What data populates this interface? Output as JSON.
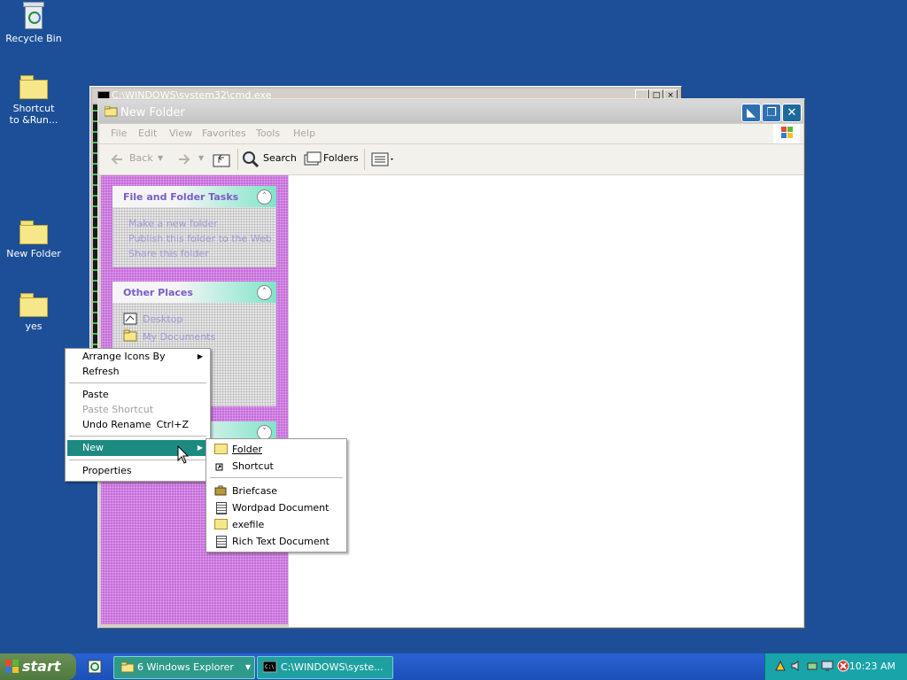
{
  "desktop": {
    "icons": [
      {
        "label": "Recycle Bin"
      },
      {
        "label": "Shortcut to &Run..."
      },
      {
        "label": "New Folder"
      },
      {
        "label": "yes"
      }
    ]
  },
  "console_window": {
    "title": "C:\\WINDOWS\\system32\\cmd.exe"
  },
  "explorer": {
    "title": "New Folder",
    "menu": [
      "File",
      "Edit",
      "View",
      "Favorites",
      "Tools",
      "Help"
    ],
    "toolbar": {
      "back": "Back",
      "search": "Search",
      "folders": "Folders"
    },
    "tasks_panel": {
      "title": "File and Folder Tasks",
      "links": [
        "Make a new folder",
        "Publish this folder to the Web",
        "Share this folder"
      ]
    },
    "places_panel": {
      "title": "Other Places",
      "links": [
        "Desktop",
        "My Documents"
      ]
    }
  },
  "context_menu": {
    "items": [
      {
        "label": "Arrange Icons By",
        "submenu": true
      },
      {
        "label": "Refresh"
      },
      {
        "label": "Paste"
      },
      {
        "label": "Paste Shortcut",
        "disabled": true
      },
      {
        "label": "Undo Rename",
        "shortcut": "Ctrl+Z"
      },
      {
        "label": "New",
        "submenu": true,
        "selected": true
      },
      {
        "label": "Properties"
      }
    ]
  },
  "new_submenu": {
    "items": [
      {
        "label": "Folder",
        "icon": "folder-icon"
      },
      {
        "label": "Shortcut",
        "icon": "shortcut-icon"
      },
      {
        "label": "Briefcase",
        "icon": "briefcase-icon"
      },
      {
        "label": "Wordpad Document",
        "icon": "document-icon"
      },
      {
        "label": "exefile",
        "icon": "folder-icon"
      },
      {
        "label": "Rich Text Document",
        "icon": "document-icon"
      }
    ]
  },
  "taskbar": {
    "start_label": "start",
    "tasks": [
      {
        "label": "6 Windows Explorer"
      },
      {
        "label": "C:\\WINDOWS\\syste..."
      }
    ],
    "clock": "10:23 AM"
  },
  "colors": {
    "desktop": "#1c4f97",
    "left_pane": "#c66bdb",
    "menu_highlight": "#1d8a82",
    "tray": "#18a4a9"
  }
}
